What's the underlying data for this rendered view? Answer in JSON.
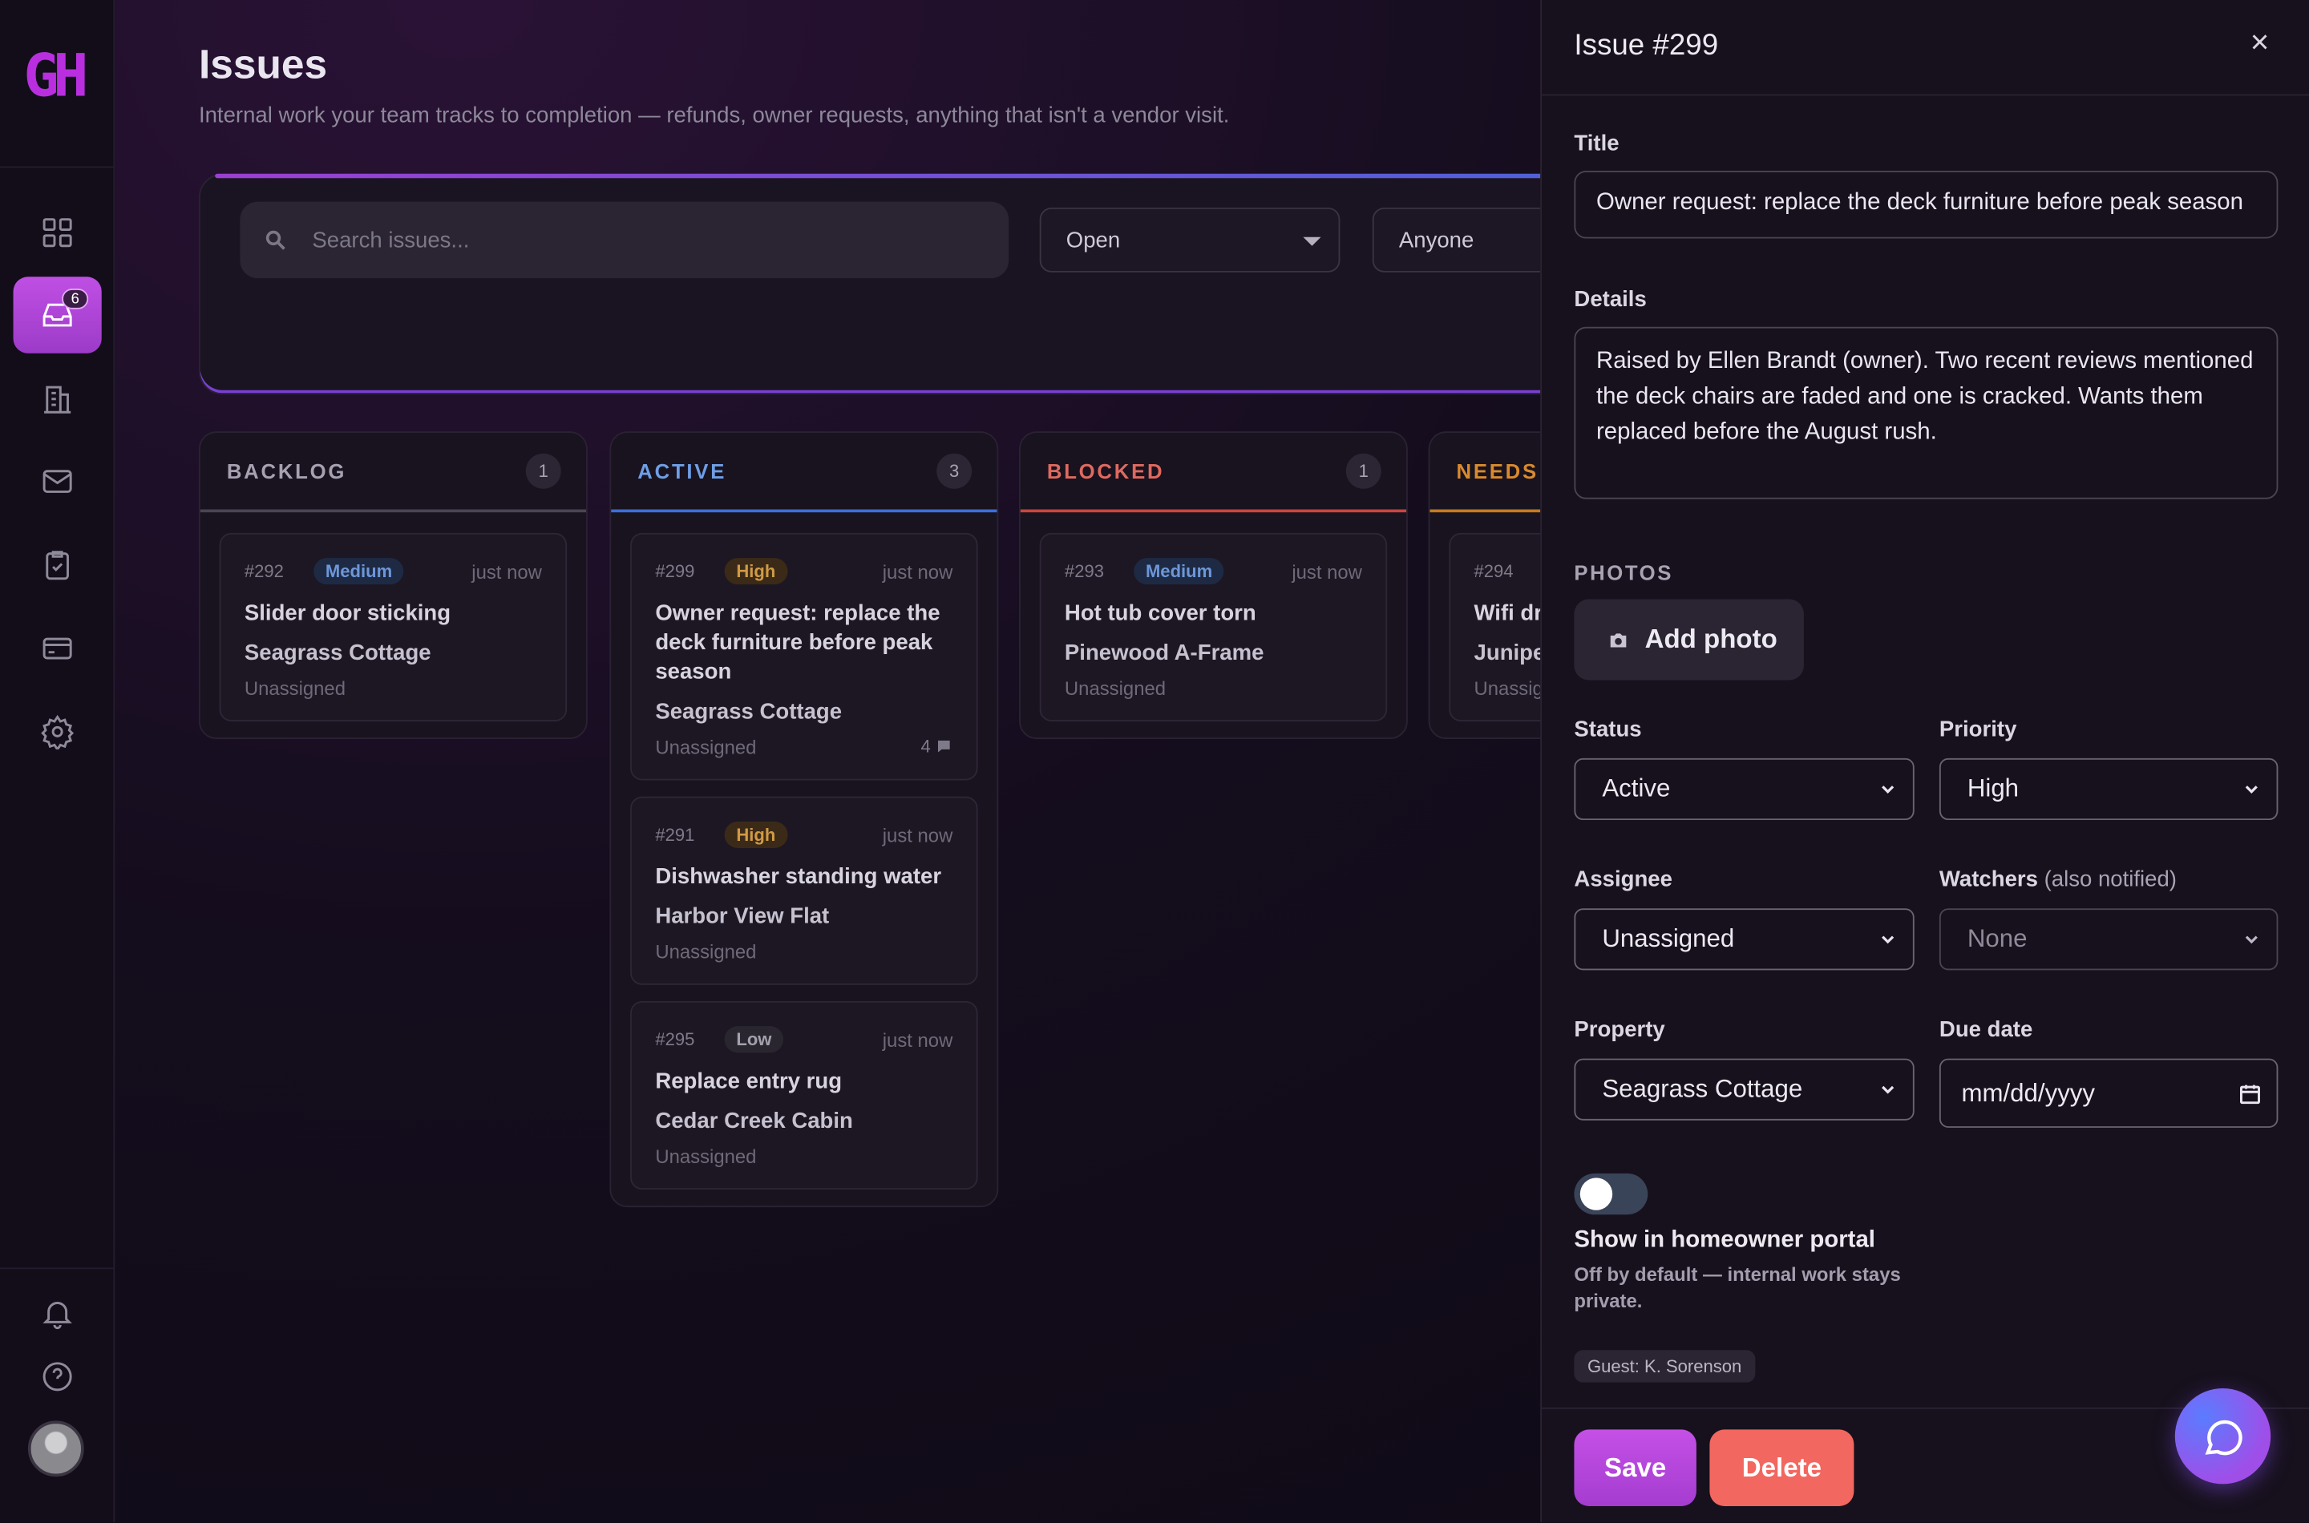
{
  "brand": {
    "logo_text": "GH",
    "accent": "#b92fe0"
  },
  "sidebar": {
    "items": [
      {
        "name": "dashboard",
        "icon": "grid-icon"
      },
      {
        "name": "issues",
        "icon": "inbox-icon",
        "badge": "6",
        "active": true
      },
      {
        "name": "properties",
        "icon": "building-icon"
      },
      {
        "name": "messages",
        "icon": "mail-icon"
      },
      {
        "name": "tasks",
        "icon": "clipboard-check-icon"
      },
      {
        "name": "billing",
        "icon": "card-icon"
      },
      {
        "name": "settings",
        "icon": "gear-icon"
      }
    ],
    "bottom": [
      {
        "name": "notifications",
        "icon": "bell-icon"
      },
      {
        "name": "help",
        "icon": "help-icon"
      }
    ]
  },
  "page": {
    "title": "Issues",
    "subtitle": "Internal work your team tracks to completion — refunds, owner requests, anything that isn't a vendor visit."
  },
  "filters": {
    "search_placeholder": "Search issues...",
    "status_value": "Open",
    "assignee_value": "Anyone"
  },
  "columns": [
    {
      "label": "BACKLOG",
      "count": "1",
      "color": "#a6a1b0",
      "line": "#4b4455",
      "cards": [
        {
          "num": "#292",
          "priority": "Medium",
          "level": "medium",
          "time": "just now",
          "title": "Slider door sticking",
          "property": "Seagrass Cottage",
          "assignee": "Unassigned"
        }
      ]
    },
    {
      "label": "ACTIVE",
      "count": "3",
      "color": "#6f9ee6",
      "line": "#3b6fd8",
      "cards": [
        {
          "num": "#299",
          "priority": "High",
          "level": "high",
          "time": "just now",
          "title": "Owner request: replace the deck furniture before peak season",
          "property": "Seagrass Cottage",
          "assignee": "Unassigned",
          "comments": "4"
        },
        {
          "num": "#291",
          "priority": "High",
          "level": "high",
          "time": "just now",
          "title": "Dishwasher standing water",
          "property": "Harbor View Flat",
          "assignee": "Unassigned"
        },
        {
          "num": "#295",
          "priority": "Low",
          "level": "low",
          "time": "just now",
          "title": "Replace entry rug",
          "property": "Cedar Creek Cabin",
          "assignee": "Unassigned"
        }
      ]
    },
    {
      "label": "BLOCKED",
      "count": "1",
      "color": "#e0695f",
      "line": "#c9453d",
      "cards": [
        {
          "num": "#293",
          "priority": "Medium",
          "level": "medium",
          "time": "just now",
          "title": "Hot tub cover torn",
          "property": "Pinewood A-Frame",
          "assignee": "Unassigned"
        }
      ]
    },
    {
      "label": "NEEDS",
      "count": "",
      "color": "#d98a2e",
      "line": "#c77a1f",
      "cards": [
        {
          "num": "#294",
          "priority": "",
          "level": "",
          "time": "",
          "title": "Wifi dr bedroo",
          "property": "Junipe",
          "assignee": "Unassig"
        }
      ]
    }
  ],
  "drawer": {
    "title": "Issue #299",
    "close_icon": "×",
    "title_label": "Title",
    "title_value": "Owner request: replace the deck furniture before peak season",
    "details_label": "Details",
    "details_value": "Raised by Ellen Brandt (owner). Two recent reviews mentioned the deck chairs are faded and one is cracked. Wants them replaced before the August rush.",
    "photos_label": "PHOTOS",
    "add_photo": "Add photo",
    "status_label": "Status",
    "status_value": "Active",
    "priority_label": "Priority",
    "priority_value": "High",
    "assignee_label": "Assignee",
    "assignee_value": "Unassigned",
    "watchers_label": "Watchers",
    "watchers_note": "(also notified)",
    "watchers_value": "None",
    "property_label": "Property",
    "property_value": "Seagrass Cottage",
    "due_label": "Due date",
    "due_placeholder": "mm/dd/yyyy",
    "portal_title": "Show in homeowner portal",
    "portal_sub": "Off by default — internal work stays private.",
    "portal_enabled": false,
    "guest_chip": "Guest: K. Sorenson",
    "save": "Save",
    "delete": "Delete"
  }
}
